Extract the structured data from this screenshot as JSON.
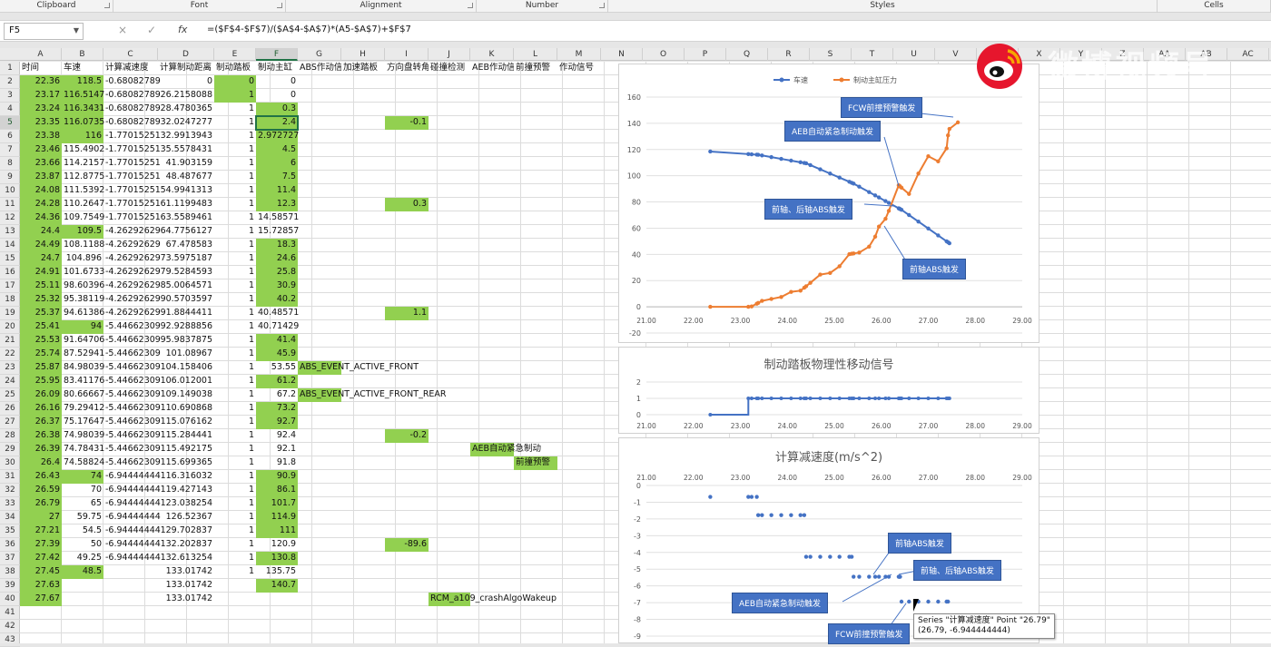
{
  "ribbon": {
    "groups": [
      {
        "label": "Clipboard",
        "left": 0,
        "width": 125
      },
      {
        "label": "Font",
        "left": 125,
        "width": 190
      },
      {
        "label": "Alignment",
        "left": 315,
        "width": 210
      },
      {
        "label": "Number",
        "left": 525,
        "width": 145
      },
      {
        "label": "Styles",
        "left": 670,
        "width": 605
      },
      {
        "label": "Cells",
        "left": 1275,
        "width": 125
      }
    ]
  },
  "formula_bar": {
    "name_box": "F5",
    "cancel_icon": "×",
    "enter_icon": "✓",
    "fx_label": "fx",
    "formula": "=($F$4-$F$7)/($A$4-$A$7)*(A5-$A$7)+$F$7"
  },
  "columns": [
    "A",
    "B",
    "C",
    "D",
    "E",
    "F",
    "G",
    "H",
    "I",
    "J",
    "K",
    "L",
    "M",
    "N",
    "O",
    "P",
    "Q",
    "R",
    "S",
    "T",
    "U",
    "V",
    "W",
    "X",
    "Y",
    "Z",
    "AA",
    "AB",
    "AC"
  ],
  "headers": [
    "时间",
    "车速",
    "计算减速度",
    "计算制动距离",
    "制动踏板",
    "制动主缸",
    "ABS作动信号",
    "加速踏板",
    "方向盘转角",
    "碰撞检测",
    "AEB作动信号",
    "前撞预警",
    "作动信号"
  ],
  "rows": [
    {
      "n": 2,
      "a": "22.36",
      "b": "118.5",
      "c": "-0.68082789",
      "d": "0",
      "e": "0",
      "f": "0"
    },
    {
      "n": 3,
      "a": "23.17",
      "b": "116.5147",
      "c": "-0.68082789",
      "d": "26.2158088",
      "e": "1",
      "f": "0"
    },
    {
      "n": 4,
      "a": "23.24",
      "b": "116.3431",
      "c": "-0.68082789",
      "d": "28.4780365",
      "e": "1",
      "f": "0.3"
    },
    {
      "n": 5,
      "a": "23.35",
      "b": "116.0735",
      "c": "-0.68082789",
      "d": "32.0247277",
      "e": "1",
      "f": "2.4",
      "i": "-0.1"
    },
    {
      "n": 6,
      "a": "23.38",
      "b": "116",
      "c": "-1.77015251",
      "d": "32.9913943",
      "e": "1",
      "f": "2.972727"
    },
    {
      "n": 7,
      "a": "23.46",
      "b": "115.4902",
      "c": "-1.77015251",
      "d": "35.5578431",
      "e": "1",
      "f": "4.5"
    },
    {
      "n": 8,
      "a": "23.66",
      "b": "114.2157",
      "c": "-1.77015251",
      "d": "41.903159",
      "e": "1",
      "f": "6"
    },
    {
      "n": 9,
      "a": "23.87",
      "b": "112.8775",
      "c": "-1.77015251",
      "d": "48.487677",
      "e": "1",
      "f": "7.5"
    },
    {
      "n": 10,
      "a": "24.08",
      "b": "111.5392",
      "c": "-1.77015251",
      "d": "54.9941313",
      "e": "1",
      "f": "11.4"
    },
    {
      "n": 11,
      "a": "24.28",
      "b": "110.2647",
      "c": "-1.77015251",
      "d": "61.1199483",
      "e": "1",
      "f": "12.3",
      "i": "0.3"
    },
    {
      "n": 12,
      "a": "24.36",
      "b": "109.7549",
      "c": "-1.77015251",
      "d": "63.5589461",
      "e": "1",
      "f": "14.58571"
    },
    {
      "n": 13,
      "a": "24.4",
      "b": "109.5",
      "c": "-4.26292629",
      "d": "64.7756127",
      "e": "1",
      "f": "15.72857"
    },
    {
      "n": 14,
      "a": "24.49",
      "b": "108.1188",
      "c": "-4.26292629",
      "d": "67.478583",
      "e": "1",
      "f": "18.3"
    },
    {
      "n": 15,
      "a": "24.7",
      "b": "104.896",
      "c": "-4.26292629",
      "d": "73.5975187",
      "e": "1",
      "f": "24.6"
    },
    {
      "n": 16,
      "a": "24.91",
      "b": "101.6733",
      "c": "-4.26292629",
      "d": "79.5284593",
      "e": "1",
      "f": "25.8"
    },
    {
      "n": 17,
      "a": "25.11",
      "b": "98.60396",
      "c": "-4.26292629",
      "d": "85.0064571",
      "e": "1",
      "f": "30.9"
    },
    {
      "n": 18,
      "a": "25.32",
      "b": "95.38119",
      "c": "-4.26292629",
      "d": "90.5703597",
      "e": "1",
      "f": "40.2"
    },
    {
      "n": 19,
      "a": "25.37",
      "b": "94.61386",
      "c": "-4.26292629",
      "d": "91.8844411",
      "e": "1",
      "f": "40.48571",
      "i": "1.1"
    },
    {
      "n": 20,
      "a": "25.41",
      "b": "94",
      "c": "-5.44662309",
      "d": "92.9288856",
      "e": "1",
      "f": "40.71429"
    },
    {
      "n": 21,
      "a": "25.53",
      "b": "91.64706",
      "c": "-5.44662309",
      "d": "95.9837875",
      "e": "1",
      "f": "41.4"
    },
    {
      "n": 22,
      "a": "25.74",
      "b": "87.52941",
      "c": "-5.44662309",
      "d": "101.08967",
      "e": "1",
      "f": "45.9"
    },
    {
      "n": 23,
      "a": "25.87",
      "b": "84.98039",
      "c": "-5.44662309",
      "d": "104.158406",
      "e": "1",
      "f": "53.55",
      "g": "ABS_EVENT_ACTIVE_FRONT"
    },
    {
      "n": 24,
      "a": "25.95",
      "b": "83.41176",
      "c": "-5.44662309",
      "d": "106.012001",
      "e": "1",
      "f": "61.2"
    },
    {
      "n": 25,
      "a": "26.09",
      "b": "80.66667",
      "c": "-5.44662309",
      "d": "109.149038",
      "e": "1",
      "f": "67.2",
      "g": "ABS_EVENT_ACTIVE_FRONT_REAR"
    },
    {
      "n": 26,
      "a": "26.16",
      "b": "79.29412",
      "c": "-5.44662309",
      "d": "110.690868",
      "e": "1",
      "f": "73.2"
    },
    {
      "n": 27,
      "a": "26.37",
      "b": "75.17647",
      "c": "-5.44662309",
      "d": "115.076162",
      "e": "1",
      "f": "92.7"
    },
    {
      "n": 28,
      "a": "26.38",
      "b": "74.98039",
      "c": "-5.44662309",
      "d": "115.284441",
      "e": "1",
      "f": "92.4",
      "i": "-0.2"
    },
    {
      "n": 29,
      "a": "26.39",
      "b": "74.78431",
      "c": "-5.44662309",
      "d": "115.492175",
      "e": "1",
      "f": "92.1",
      "k": "AEB自动紧急制动"
    },
    {
      "n": 30,
      "a": "26.4",
      "b": "74.58824",
      "c": "-5.44662309",
      "d": "115.699365",
      "e": "1",
      "f": "91.8",
      "l": "前撞预警"
    },
    {
      "n": 31,
      "a": "26.43",
      "b": "74",
      "c": "-6.94444444",
      "d": "116.316032",
      "e": "1",
      "f": "90.9"
    },
    {
      "n": 32,
      "a": "26.59",
      "b": "70",
      "c": "-6.94444444",
      "d": "119.427143",
      "e": "1",
      "f": "86.1"
    },
    {
      "n": 33,
      "a": "26.79",
      "b": "65",
      "c": "-6.94444444",
      "d": "123.038254",
      "e": "1",
      "f": "101.7"
    },
    {
      "n": 34,
      "a": "27",
      "b": "59.75",
      "c": "-6.94444444",
      "d": "126.52367",
      "e": "1",
      "f": "114.9"
    },
    {
      "n": 35,
      "a": "27.21",
      "b": "54.5",
      "c": "-6.94444444",
      "d": "129.702837",
      "e": "1",
      "f": "111"
    },
    {
      "n": 36,
      "a": "27.39",
      "b": "50",
      "c": "-6.94444444",
      "d": "132.202837",
      "e": "1",
      "f": "120.9",
      "i": "-89.6"
    },
    {
      "n": 37,
      "a": "27.42",
      "b": "49.25",
      "c": "-6.94444444",
      "d": "132.613254",
      "e": "1",
      "f": "130.8"
    },
    {
      "n": 38,
      "a": "27.45",
      "b": "48.5",
      "c": "",
      "d": "133.01742",
      "e": "1",
      "f": "135.75"
    },
    {
      "n": 39,
      "a": "27.63",
      "b": "",
      "c": "",
      "d": "133.01742",
      "e": "",
      "f": "140.7"
    },
    {
      "n": 40,
      "a": "27.67",
      "b": "",
      "c": "",
      "d": "133.01742",
      "e": "",
      "f": "",
      "j": "RCM_a109_crashAlgoWakeup"
    },
    {
      "n": 41
    },
    {
      "n": 42
    },
    {
      "n": 43
    }
  ],
  "green_cells": {
    "a": [
      2,
      3,
      4,
      5,
      6,
      7,
      8,
      9,
      10,
      11,
      12,
      13,
      14,
      15,
      16,
      17,
      18,
      19,
      20,
      21,
      22,
      23,
      24,
      25,
      26,
      27,
      28,
      29,
      30,
      31,
      32,
      33,
      34,
      35,
      36,
      37,
      38,
      39,
      40
    ],
    "b": [
      2,
      3,
      4,
      5,
      6,
      13,
      20,
      31,
      38
    ],
    "e": [
      2,
      3
    ],
    "f": [
      4,
      5,
      6,
      7,
      8,
      9,
      10,
      11,
      14,
      15,
      16,
      17,
      18,
      21,
      22,
      24,
      26,
      27,
      31,
      32,
      33,
      34,
      35,
      37,
      39
    ],
    "g": [
      23,
      25
    ],
    "i": [
      5,
      11,
      19,
      28,
      36
    ],
    "j": [
      40
    ],
    "k": [
      29
    ],
    "l": [
      30
    ]
  },
  "chart1": {
    "chart_data": {
      "type": "line",
      "xlim": [
        21,
        29
      ],
      "ylim": [
        -20,
        160
      ],
      "xticks": [
        "21.00",
        "22.00",
        "23.00",
        "24.00",
        "25.00",
        "26.00",
        "27.00",
        "28.00",
        "29.00"
      ],
      "yticks": [
        "-20",
        "0",
        "20",
        "40",
        "60",
        "80",
        "100",
        "120",
        "140",
        "160"
      ],
      "series": [
        {
          "name": "车速",
          "color": "#4472c4",
          "x": [
            22.36,
            23.17,
            23.24,
            23.35,
            23.38,
            23.46,
            23.66,
            23.87,
            24.08,
            24.28,
            24.36,
            24.4,
            24.49,
            24.7,
            24.91,
            25.11,
            25.32,
            25.37,
            25.41,
            25.53,
            25.74,
            25.87,
            25.95,
            26.09,
            26.16,
            26.37,
            26.38,
            26.39,
            26.4,
            26.43,
            26.59,
            26.79,
            27,
            27.21,
            27.39,
            27.42,
            27.45
          ],
          "y": [
            118.5,
            116.5147,
            116.3431,
            116.0735,
            116,
            115.4902,
            114.2157,
            112.8775,
            111.5392,
            110.2647,
            109.7549,
            109.5,
            108.1188,
            104.896,
            101.6733,
            98.60396,
            95.38119,
            94.61386,
            94,
            91.64706,
            87.52941,
            84.98039,
            83.41176,
            80.66667,
            79.29412,
            75.17647,
            74.98039,
            74.78431,
            74.58824,
            74,
            70,
            65,
            59.75,
            54.5,
            50,
            49.25,
            48.5
          ]
        },
        {
          "name": "制动主缸压力",
          "color": "#ed7d31",
          "x": [
            22.36,
            23.17,
            23.24,
            23.35,
            23.38,
            23.46,
            23.66,
            23.87,
            24.08,
            24.28,
            24.36,
            24.4,
            24.49,
            24.7,
            24.91,
            25.11,
            25.32,
            25.37,
            25.41,
            25.53,
            25.74,
            25.87,
            25.95,
            26.09,
            26.16,
            26.37,
            26.38,
            26.39,
            26.4,
            26.43,
            26.59,
            26.79,
            27,
            27.21,
            27.39,
            27.42,
            27.45,
            27.63
          ],
          "y": [
            0,
            0,
            0.3,
            2.4,
            2.972727,
            4.5,
            6,
            7.5,
            11.4,
            12.3,
            14.58571,
            15.72857,
            18.3,
            24.6,
            25.8,
            30.9,
            40.2,
            40.48571,
            40.71429,
            41.4,
            45.9,
            53.55,
            61.2,
            67.2,
            73.2,
            92.7,
            92.4,
            92.1,
            91.8,
            90.9,
            86.1,
            101.7,
            114.9,
            111,
            120.9,
            130.8,
            135.75,
            140.7
          ]
        }
      ]
    },
    "callouts": [
      "FCW前撞预警触发",
      "AEB自动紧急制动触发",
      "前轴、后轴ABS触发",
      "前轴ABS触发"
    ]
  },
  "chart2": {
    "title": "制动踏板物理性移动信号",
    "chart_data": {
      "type": "line",
      "xlim": [
        21,
        29
      ],
      "ylim": [
        0,
        2
      ],
      "xticks": [
        "21.00",
        "22.00",
        "23.00",
        "24.00",
        "25.00",
        "26.00",
        "27.00",
        "28.00",
        "29.00"
      ],
      "yticks": [
        "0",
        "1",
        "2"
      ],
      "series": [
        {
          "color": "#4472c4",
          "x": [
            22.36,
            23.17,
            23.24,
            23.35,
            23.38,
            23.46,
            23.66,
            23.87,
            24.08,
            24.28,
            24.36,
            24.4,
            24.49,
            24.7,
            24.91,
            25.11,
            25.32,
            25.37,
            25.41,
            25.53,
            25.74,
            25.87,
            25.95,
            26.09,
            26.16,
            26.37,
            26.38,
            26.39,
            26.4,
            26.43,
            26.59,
            26.79,
            27,
            27.21,
            27.39,
            27.42,
            27.45
          ],
          "y": [
            0,
            1,
            1,
            1,
            1,
            1,
            1,
            1,
            1,
            1,
            1,
            1,
            1,
            1,
            1,
            1,
            1,
            1,
            1,
            1,
            1,
            1,
            1,
            1,
            1,
            1,
            1,
            1,
            1,
            1,
            1,
            1,
            1,
            1,
            1,
            1,
            1
          ]
        }
      ]
    }
  },
  "chart3": {
    "title": "计算减速度(m/s^2)",
    "chart_data": {
      "type": "scatter",
      "xlim": [
        21,
        29
      ],
      "ylim": [
        -9,
        0
      ],
      "xticks": [
        "21.00",
        "22.00",
        "23.00",
        "24.00",
        "25.00",
        "26.00",
        "27.00",
        "28.00",
        "29.00"
      ],
      "yticks": [
        "0",
        "-1",
        "-2",
        "-3",
        "-4",
        "-5",
        "-6",
        "-7",
        "-8",
        "-9"
      ],
      "series": [
        {
          "name": "计算减速度",
          "color": "#4472c4",
          "x": [
            22.36,
            23.17,
            23.24,
            23.35,
            23.38,
            23.46,
            23.66,
            23.87,
            24.08,
            24.28,
            24.36,
            24.4,
            24.49,
            24.7,
            24.91,
            25.11,
            25.32,
            25.37,
            25.41,
            25.53,
            25.74,
            25.87,
            25.95,
            26.09,
            26.16,
            26.37,
            26.38,
            26.39,
            26.4,
            26.43,
            26.59,
            26.79,
            27,
            27.21,
            27.39,
            27.42
          ],
          "y": [
            -0.68,
            -0.68,
            -0.68,
            -0.68,
            -1.77,
            -1.77,
            -1.77,
            -1.77,
            -1.77,
            -1.77,
            -1.77,
            -4.26,
            -4.26,
            -4.26,
            -4.26,
            -4.26,
            -4.26,
            -4.26,
            -5.45,
            -5.45,
            -5.45,
            -5.45,
            -5.45,
            -5.45,
            -5.45,
            -5.45,
            -5.45,
            -5.45,
            -5.45,
            -6.94,
            -6.94,
            -6.94,
            -6.94,
            -6.94,
            -6.94,
            -6.94
          ]
        }
      ]
    },
    "callouts": [
      "前轴ABS触发",
      "前轴、后轴ABS触发",
      "AEB自动紧急制动触发",
      "FCW前撞预警触发"
    ],
    "tooltip_line1": "Series \"计算减速度\" Point \"26.79\"",
    "tooltip_line2": "(26.79, -6.944444444)"
  },
  "watermark": {
    "text": "微博视频号"
  }
}
